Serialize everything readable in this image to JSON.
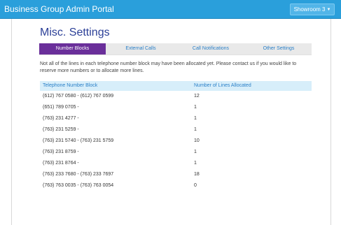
{
  "header": {
    "brand": "Business Group Admin Portal",
    "profile_dropdown": "Showroom 3"
  },
  "page": {
    "title": "Misc. Settings"
  },
  "tabs": [
    {
      "label": "Number Blocks",
      "active": true
    },
    {
      "label": "External Calls",
      "active": false
    },
    {
      "label": "Call Notifications",
      "active": false
    },
    {
      "label": "Other Settings",
      "active": false
    }
  ],
  "notice": "Not all of the lines in each telephone number block may have been allocated yet. Please contact us if you would like to reserve more numbers or to allocate more lines.",
  "table": {
    "columns": [
      "Telephone Number Block",
      "Number of Lines Allocated"
    ],
    "rows": [
      {
        "block": "(612) 767 0580  -  (612) 767 0599",
        "lines": "12"
      },
      {
        "block": "(651) 789 0705  -",
        "lines": "1"
      },
      {
        "block": "(763) 231 4277  -",
        "lines": "1"
      },
      {
        "block": "(763) 231 5259  -",
        "lines": "1"
      },
      {
        "block": "(763) 231 5740  -  (763) 231 5759",
        "lines": "10"
      },
      {
        "block": "(763) 231 8759  -",
        "lines": "1"
      },
      {
        "block": "(763) 231 8764  -",
        "lines": "1"
      },
      {
        "block": "(763) 233 7680  -  (763) 233 7697",
        "lines": "18"
      },
      {
        "block": "(763) 763 0035  -  (763) 763 0054",
        "lines": "0"
      }
    ]
  },
  "colors": {
    "topbar": "#2a9fdb",
    "title": "#2b3f97",
    "active_tab": "#6a2f9a",
    "link": "#2b80c8",
    "table_header": "#d7eefa"
  }
}
